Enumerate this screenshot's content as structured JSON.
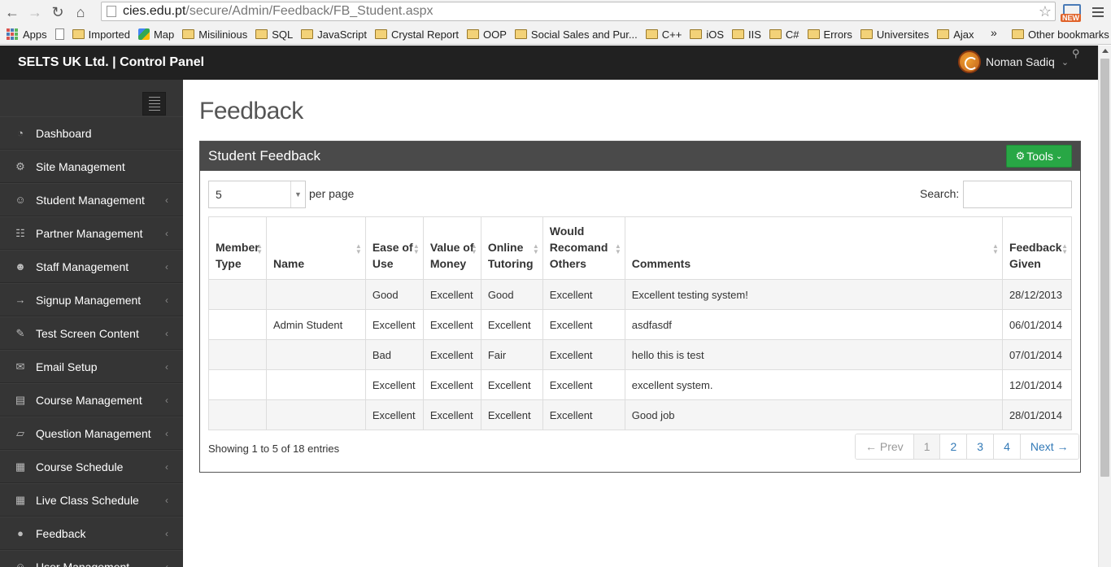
{
  "browser": {
    "url_host": "cies.edu.pt",
    "url_path": "/secure/Admin/Feedback/FB_Student.aspx",
    "ext_label": "NEW",
    "bookmarks": [
      "Apps",
      "Imported",
      "Map",
      "Misilinious",
      "SQL",
      "JavaScript",
      "Crystal Report",
      "OOP",
      "Social Sales and Pur...",
      "C++",
      "iOS",
      "IIS",
      "C#",
      "Errors",
      "Universites",
      "Ajax"
    ],
    "overflow": "»",
    "other_bookmarks": "Other bookmarks"
  },
  "header": {
    "brand": "SELTS UK Ltd. | Control Panel",
    "user_name": "Noman Sadiq"
  },
  "sidebar": {
    "items": [
      {
        "label": "Dashboard",
        "icon": "dashboard-icon",
        "caret": ""
      },
      {
        "label": "Site Management",
        "icon": "cogs-icon",
        "caret": ""
      },
      {
        "label": "Student Management",
        "icon": "user-icon",
        "caret": "‹"
      },
      {
        "label": "Partner Management",
        "icon": "sitemap-icon",
        "caret": "‹"
      },
      {
        "label": "Staff Management",
        "icon": "users-icon",
        "caret": "‹"
      },
      {
        "label": "Signup Management",
        "icon": "sign-in-icon",
        "caret": "‹"
      },
      {
        "label": "Test Screen Content",
        "icon": "edit-icon",
        "caret": "‹"
      },
      {
        "label": "Email Setup",
        "icon": "envelope-icon",
        "caret": "‹"
      },
      {
        "label": "Course Management",
        "icon": "book-icon",
        "caret": "‹"
      },
      {
        "label": "Question Management",
        "icon": "folder-open-icon",
        "caret": "‹"
      },
      {
        "label": "Course Schedule",
        "icon": "calendar-icon",
        "caret": "‹"
      },
      {
        "label": "Live Class Schedule",
        "icon": "calendar-icon",
        "caret": "‹"
      },
      {
        "label": "Feedback",
        "icon": "comments-icon",
        "caret": "‹"
      },
      {
        "label": "User Management",
        "icon": "user-icon",
        "caret": "‹"
      }
    ]
  },
  "main": {
    "page_title": "Feedback",
    "panel_title": "Student Feedback",
    "tools_label": "Tools",
    "page_length": "5",
    "per_page_label": "per page",
    "search_label": "Search:",
    "search_value": "",
    "columns": [
      "Member Type",
      "Name",
      "Ease of Use",
      "Value of Money",
      "Online Tutoring",
      "Would Recomand Others",
      "Comments",
      "Feedback Given"
    ],
    "rows": [
      [
        "",
        "",
        "Good",
        "Excellent",
        "Good",
        "Excellent",
        "Excellent testing system!",
        "28/12/2013"
      ],
      [
        "",
        "Admin Student",
        "Excellent",
        "Excellent",
        "Excellent",
        "Excellent",
        "asdfasdf",
        "06/01/2014"
      ],
      [
        "",
        "",
        "Bad",
        "Excellent",
        "Fair",
        "Excellent",
        "hello this is test",
        "07/01/2014"
      ],
      [
        "",
        "",
        "Excellent",
        "Excellent",
        "Excellent",
        "Excellent",
        "excellent system.",
        "12/01/2014"
      ],
      [
        "",
        "",
        "Excellent",
        "Excellent",
        "Excellent",
        "Excellent",
        "Good job",
        "28/01/2014"
      ]
    ],
    "info": "Showing 1 to 5 of 18 entries",
    "pager": {
      "prev": "← Prev",
      "pages": [
        "1",
        "2",
        "3",
        "4"
      ],
      "next": "Next →",
      "current": "1"
    }
  },
  "colors": {
    "header_bg": "#212121",
    "sidebar_bg": "#353535",
    "panel_head_bg": "#4a4a4a",
    "tools_green": "#28a745",
    "link_blue": "#337ab7"
  }
}
